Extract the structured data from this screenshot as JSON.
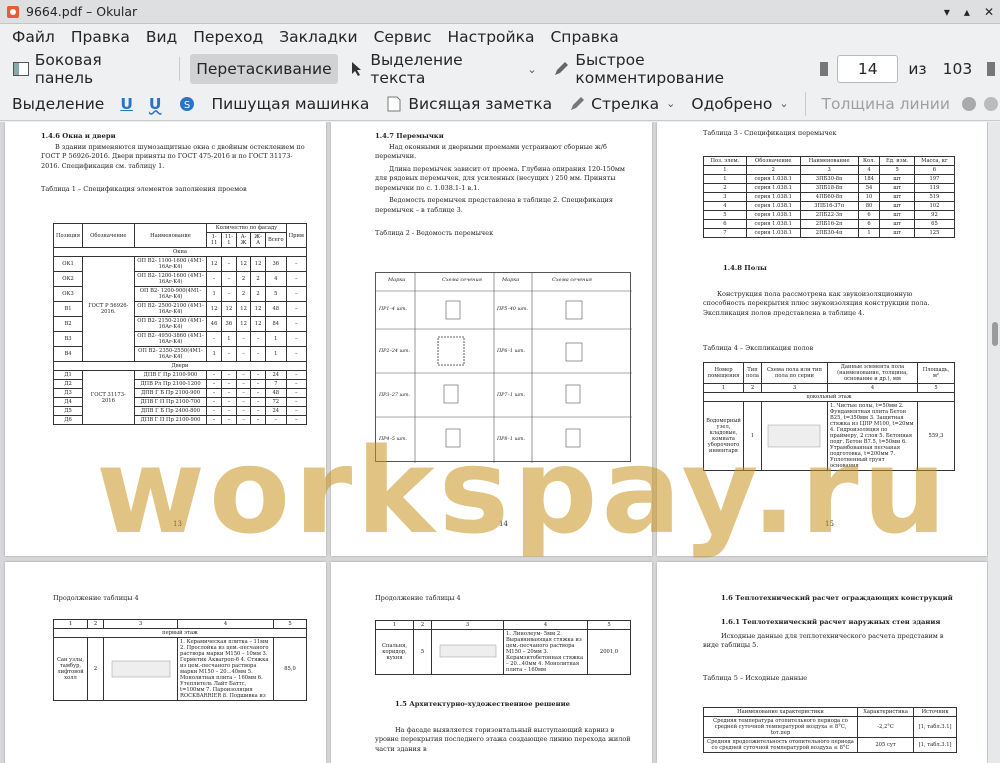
{
  "window": {
    "title": "9664.pdf – Okular"
  },
  "menubar": {
    "items": [
      "Файл",
      "Правка",
      "Вид",
      "Переход",
      "Закладки",
      "Сервис",
      "Настройка",
      "Справка"
    ]
  },
  "toolbar1": {
    "sidebar": "Боковая панель",
    "drag": "Перетаскивание",
    "text_select": "Выделение текста",
    "quick_comment": "Быстрое комментирование",
    "page_current": "14",
    "page_of": "из",
    "page_total": "103"
  },
  "toolbar2": {
    "select": "Выделение",
    "u1": "U",
    "u2": "U",
    "typewriter": "Пишущая машинка",
    "inline_note": "Висящая заметка",
    "arrow": "Стрелка",
    "approved": "Одобрено",
    "line_width": "Толщина линии"
  },
  "watermark": "workspay.ru",
  "page13": {
    "heading": "1.4.6 Окна и двери",
    "para": "В здании применяются шумозащитные окна с двойным остеклением по ГОСТ Р 56926-2016. Двери приняты по ГОСТ 475-2016 и по ГОСТ 31173-2016. Спецификация см. таблицу 1.",
    "caption": "Таблица 1 – Спецификация элементов заполнения проемов",
    "headers": [
      "Позиция",
      "Обозначение",
      "Наименование",
      "Количество по фасаду",
      "Прим"
    ],
    "subheaders": [
      "1-11",
      "11-1",
      "А-Ж",
      "Ж-А",
      "Всего"
    ],
    "section_windows": "Окна",
    "section_doors": "Двери",
    "window_rows": [
      [
        "ОК1",
        "ОП В2- 1100-1600 (4М1-16Ar-K4)",
        "12",
        "–",
        "12",
        "12",
        "36",
        "–"
      ],
      [
        "ОК2",
        "ОП В2- 1200-1600 (4М1-16Ar-K4)",
        "–",
        "–",
        "2",
        "2",
        "4",
        "–"
      ],
      [
        "ОК3",
        "ОП В2- 1200-900(4М1-16Ar-K4)",
        "1",
        "–",
        "2",
        "2",
        "5",
        "–"
      ],
      [
        "В1",
        "ОП В2- 2500-2100 (4М1-16Ar-K4)",
        "12",
        "12",
        "12",
        "12",
        "48",
        "–"
      ],
      [
        "В2",
        "ОП В2- 2150-2100 (4М1-16Ar-K4)",
        "46",
        "36",
        "12",
        "12",
        "84",
        "–"
      ],
      [
        "В3",
        "ОП В2- 4950-3860 (4М1-16Ar-K4)",
        "–",
        "1",
        "–",
        "–",
        "1",
        "–"
      ],
      [
        "В4",
        "ОП В2- 2350-2550(4М1-16Ar-K4)",
        "1",
        "–",
        "–",
        "–",
        "1",
        "–"
      ]
    ],
    "window_gost": "ГОСТ Р 56926-2016.",
    "door_rows": [
      [
        "Д1",
        "ДПВ Г Пр 2100-900",
        "24"
      ],
      [
        "Д2",
        "ДПВ Рл Пр 2100-1200",
        "7"
      ],
      [
        "Д3",
        "ДПВ Г Б Пр 2100-900",
        "48"
      ],
      [
        "Д4",
        "ДПВ Г П Пр 2100-700",
        "72"
      ],
      [
        "Д5",
        "ДПВ Г Б Пр 2400-800",
        "24"
      ],
      [
        "Д6",
        "ДПВ Г П Пр 2100-900",
        "–"
      ]
    ],
    "door_gost": "ГОСТ 31173-2016",
    "number": "13"
  },
  "page14": {
    "heading": "1.4.7 Перемычки",
    "para1": "Над оконными и дверными проемами устраивают сборные ж/б перемычки.",
    "para2": "Длина перемычек зависит от проема. Глубина опирания 120-150мм для рядовых перемычек, для усиленных (несущих ) 250 мм. Приняты перемычки по с. 1.038.1-1 в.1.",
    "para3": "Ведомость перемычек представлена в таблице 2. Спецификация перемычек – в таблице 3.",
    "caption": "Таблица 2 - Ведомость перемычек",
    "col_mark": "Марка",
    "col_section": "Схема сечения",
    "marks": [
      "ПР1–4 шт.",
      "ПР5–40 шт.",
      "ПР2–24 шт.",
      "ПР6–1 шт.",
      "ПР3–27 шт.",
      "ПР7–1 шт.",
      "ПР4–5 шт.",
      "ПР8–1 шт."
    ],
    "number": "14"
  },
  "page15": {
    "caption3": "Таблица 3 - Спецификация перемычек",
    "t3_headers": [
      "Поз. элем.",
      "Обозначение",
      "Наименование",
      "Кол.",
      "Ед. изм.",
      "Масса, кг"
    ],
    "t3_nums": [
      "1",
      "2",
      "3",
      "4",
      "5",
      "6"
    ],
    "t3_rows": [
      [
        "1",
        "серия 1.038.1",
        "3ПБ30-8п",
        "184",
        "шт",
        "197"
      ],
      [
        "2",
        "серия 1.038.1",
        "3ПБ18-8п",
        "54",
        "шт",
        "119"
      ],
      [
        "3",
        "серия 1.038.1",
        "4ПБ60-8п",
        "10",
        "шт",
        "519"
      ],
      [
        "4",
        "серия 1.038.1",
        "3ПБ16-37п",
        "80",
        "шт",
        "102"
      ],
      [
        "5",
        "серия 1.038.1",
        "2ПБ22-3п",
        "6",
        "шт",
        "92"
      ],
      [
        "6",
        "серия 1.038.1",
        "2ПБ16-2п",
        "6",
        "шт",
        "65"
      ],
      [
        "7",
        "серия 1.038.1",
        "2ПБ30-4п",
        "1",
        "шт",
        "125"
      ]
    ],
    "heading": "1.4.8 Полы",
    "para": "Конструкция пола рассмотрена как звукоизоляционную способность перекрытия плюс звукоизоляция конструкции пола. Экспликация полов представлена в таблице 4.",
    "caption4": "Таблица 4 – Экспликация полов",
    "t4_headers": [
      "Номер помещения",
      "Тип пола",
      "Схема пола или тип пола по серии",
      "Данные элемента пола (наименование, толщина, основание и др.), мм",
      "Площадь, м²"
    ],
    "t4_nums": [
      "1",
      "2",
      "3",
      "4",
      "5"
    ],
    "t4_floor": "цокольный этаж",
    "t4_room": "Водомерный узел, кладовые, комната уборочного инвентаря",
    "t4_type": "1",
    "t4_layers": "1. Чистые полы, t=50мм 2. Фундаментная плита Бетон В25, t=350мм 3. Защитная стяжка из ЦПР М100, t=20мм 4. Гидроизоляция по праймеру, 2 слоя 5. Бетонная подг. Бетон В7.5, t=50мм 6. Утрамбованная песчаная подготовка, t=200мм 7. Уплотненный грунт основания",
    "t4_area": "559,3",
    "number": "15"
  },
  "page16": {
    "caption": "Продолжение таблицы 4",
    "nums": [
      "1",
      "2",
      "3",
      "4",
      "5"
    ],
    "floor": "первый этаж",
    "room": "Сан узлы, тамбур, лифтовой холл",
    "type": "2",
    "layers": "1. Керамическая плитка – 11мм 2. Прослойка из цем.-песчаного раствора марки М150 – 10мм 3. Герметик Аквагроп-6 4. Стяжка из цем.-песчаного раствора марки М150 – 20...40мм 5. Монолитная плита – 160мм 6. Утеплитель Лайт Баттс, t=100мм 7. Пароизоляция ROCKBARRIER 8. Подшивка из",
    "area": "85,0"
  },
  "page17": {
    "caption": "Продолжение таблицы 4",
    "nums": [
      "1",
      "2",
      "3",
      "4",
      "5"
    ],
    "room": "Спальня, коридор, кухня",
    "type": "5",
    "layers": "1. Линолеум- 5мм 2. Выравнивающая стяжка из цем.-песчаного раствора М150 – 20мм 3. Керамзитобетонная стяжка – 20...40мм 4. Монолитная плита – 160мм",
    "area": "2001,0",
    "heading": "1.5 Архитектурно-художественное решение",
    "para": "На фасаде выявляется горизонтальный выступающий карниз в уровне перекрытия последнего этажа создающее линию перехода жилой части здания в"
  },
  "page18": {
    "heading1": "1.6 Теплотехнический расчет ограждающих конструкций",
    "heading2": "1.6.1 Теплотехнический расчет наружных стен здания",
    "para": "Исходные данные для теплотехнического расчета представим в виде таблицы 5.",
    "caption": "Таблица 5 – Исходные данные",
    "headers": [
      "Наименование характеристики",
      "Характеристика",
      "Источник"
    ],
    "rows": [
      [
        "Средняя температура отопительного периода со средней суточной температурой воздуха ≤ 8°С, tот.пер",
        "-2,2°С",
        "[1, табл.3.1]"
      ],
      [
        "Средняя продолжительность отопительного периода со средней суточной температурой воздуха ≤ 8°С",
        "205 сут",
        "[1, табл.3.1]"
      ]
    ]
  }
}
